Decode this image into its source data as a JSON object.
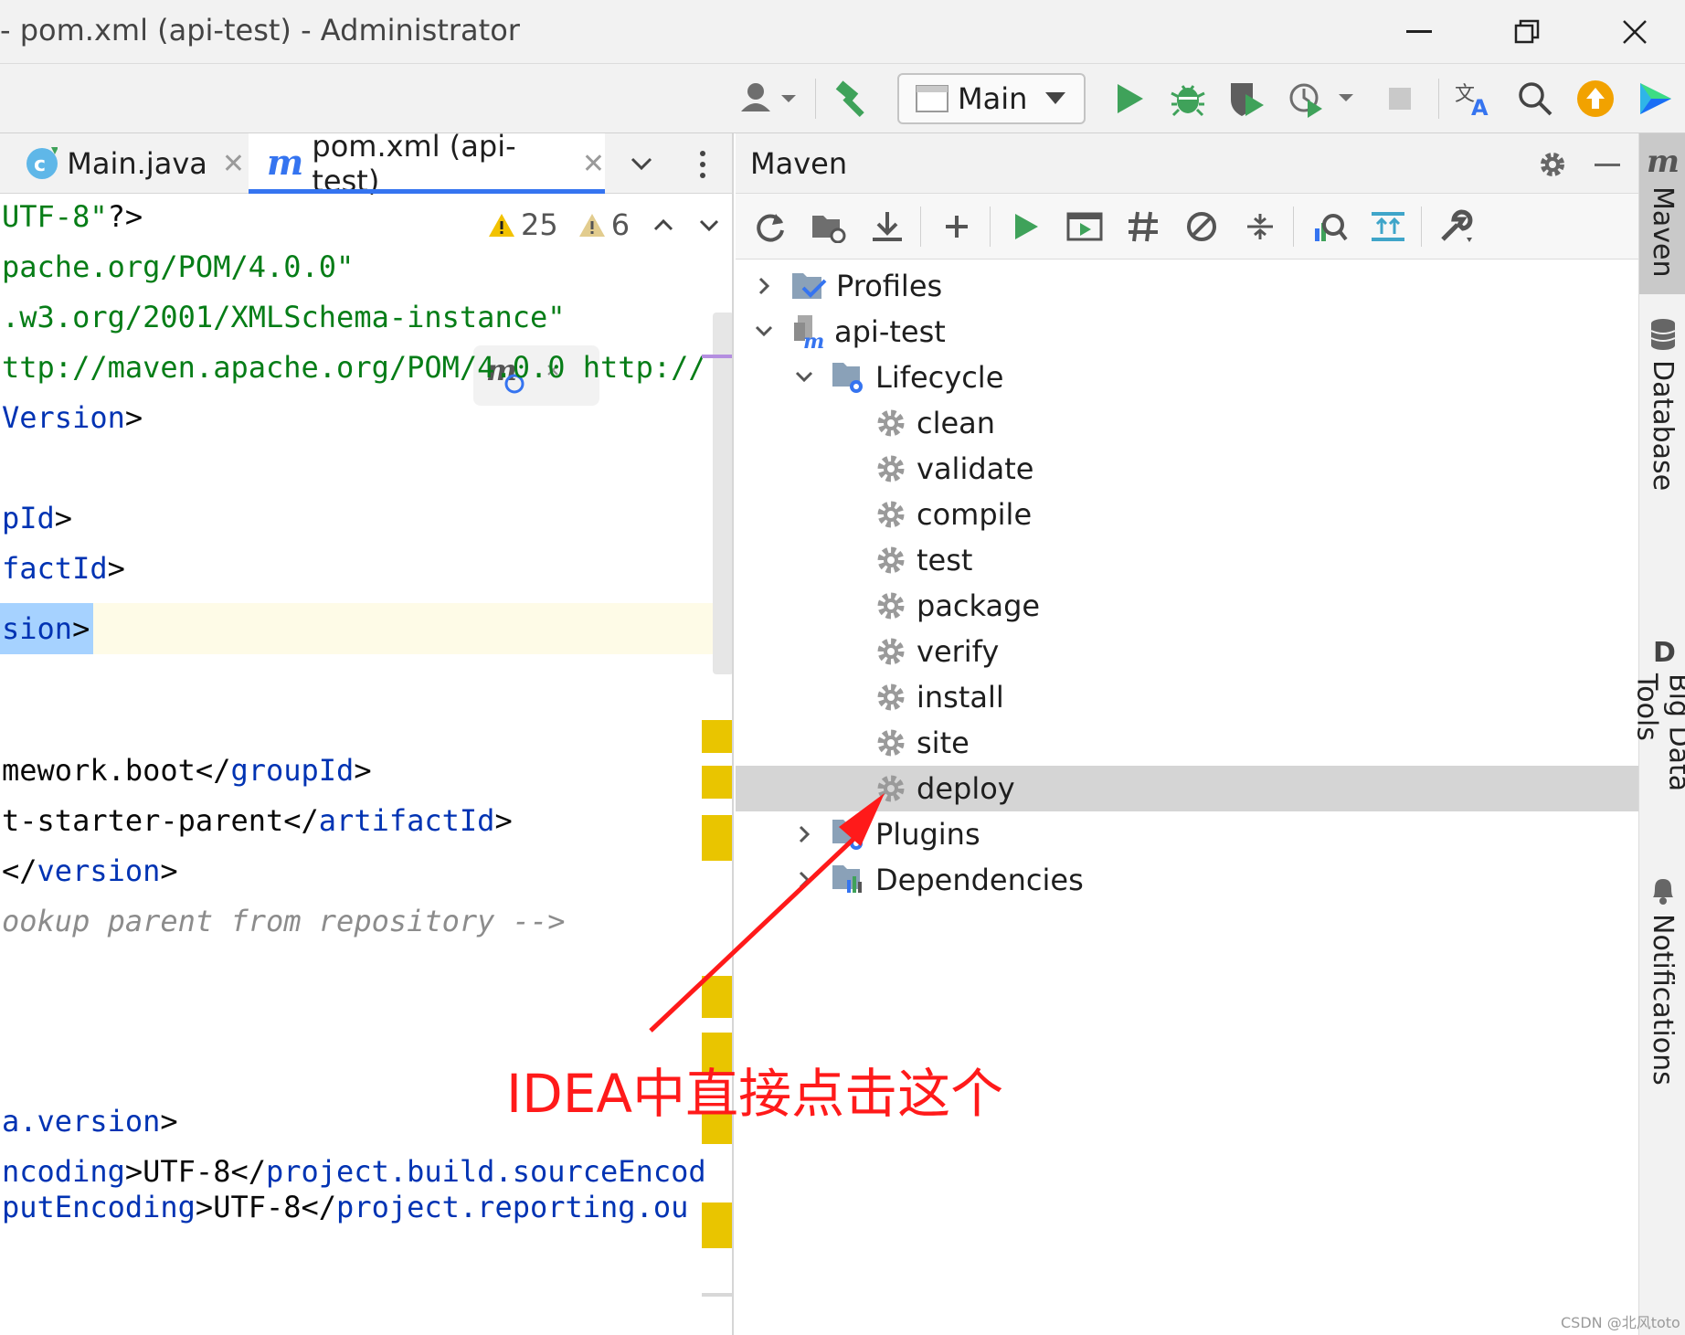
{
  "window": {
    "title": "- pom.xml (api-test) - Administrator"
  },
  "toolbar": {
    "run_config": "Main"
  },
  "editor": {
    "tabs": [
      {
        "label": "Main.java",
        "active": false
      },
      {
        "label": "pom.xml (api-test)",
        "active": true
      }
    ],
    "inspections": {
      "warnings": "25",
      "weak_warnings": "6"
    },
    "lines": [
      {
        "parts": [
          {
            "t": "UTF-8\"",
            "c": "str"
          },
          {
            "t": "?>",
            "c": "txt"
          }
        ]
      },
      {
        "parts": [
          {
            "t": "pache.org/POM/4.0.0\"",
            "c": "str"
          }
        ]
      },
      {
        "parts": [
          {
            "t": ".w3.org/2001/XMLSchema-instance\"",
            "c": "str"
          }
        ]
      },
      {
        "parts": [
          {
            "t": "ttp://maven.apache.org/POM/4.0.0 http://",
            "c": "str"
          }
        ]
      },
      {
        "parts": [
          {
            "t": "Version",
            "c": "tag"
          },
          {
            "t": ">",
            "c": "txt"
          }
        ]
      },
      {
        "parts": [
          {
            "t": "pId",
            "c": "tag"
          },
          {
            "t": ">",
            "c": "txt"
          }
        ]
      },
      {
        "parts": [
          {
            "t": "factId",
            "c": "tag"
          },
          {
            "t": ">",
            "c": "txt"
          }
        ]
      },
      {
        "parts": [
          {
            "t": "sion",
            "c": "tag"
          },
          {
            "t": ">",
            "c": "txt"
          }
        ]
      },
      {
        "parts": [
          {
            "t": "mework.boot</",
            "c": "txt"
          },
          {
            "t": "groupId",
            "c": "tag"
          },
          {
            "t": ">",
            "c": "txt"
          }
        ]
      },
      {
        "parts": [
          {
            "t": "t-starter-parent</",
            "c": "txt"
          },
          {
            "t": "artifactId",
            "c": "tag"
          },
          {
            "t": ">",
            "c": "txt"
          }
        ]
      },
      {
        "parts": [
          {
            "t": "</",
            "c": "txt"
          },
          {
            "t": "version",
            "c": "tag"
          },
          {
            "t": ">",
            "c": "txt"
          }
        ]
      },
      {
        "parts": [
          {
            "t": "ookup parent from repository -->",
            "c": "cmt"
          }
        ]
      },
      {
        "parts": [
          {
            "t": "a.version",
            "c": "tag"
          },
          {
            "t": ">",
            "c": "txt"
          }
        ]
      },
      {
        "parts": [
          {
            "t": "ncoding",
            "c": "tag"
          },
          {
            "t": ">UTF-8</",
            "c": "txt"
          },
          {
            "t": "project.build.sourceEncod",
            "c": "tag"
          }
        ]
      },
      {
        "parts": [
          {
            "t": "putEncoding",
            "c": "tag"
          },
          {
            "t": ">UTF-8</",
            "c": "txt"
          },
          {
            "t": "project.reporting.ou",
            "c": "tag"
          }
        ]
      }
    ]
  },
  "maven": {
    "title": "Maven",
    "tree": {
      "profiles": "Profiles",
      "project": "api-test",
      "lifecycle": "Lifecycle",
      "goals": [
        "clean",
        "validate",
        "compile",
        "test",
        "package",
        "verify",
        "install",
        "site",
        "deploy"
      ],
      "selected_goal": "deploy",
      "plugins": "Plugins",
      "dependencies": "Dependencies"
    }
  },
  "right_stripe": {
    "items": [
      "Maven",
      "Database",
      "Big Data Tools",
      "Notifications"
    ]
  },
  "annotation": {
    "text": "IDEA中直接点击这个",
    "color": "#ff1a1a"
  },
  "watermark": "CSDN @北风toto",
  "colors": {
    "accent": "#3574f0",
    "run_green": "#3fa25a",
    "warning_yellow": "#e9c500",
    "selection": "#d5d5d5"
  }
}
